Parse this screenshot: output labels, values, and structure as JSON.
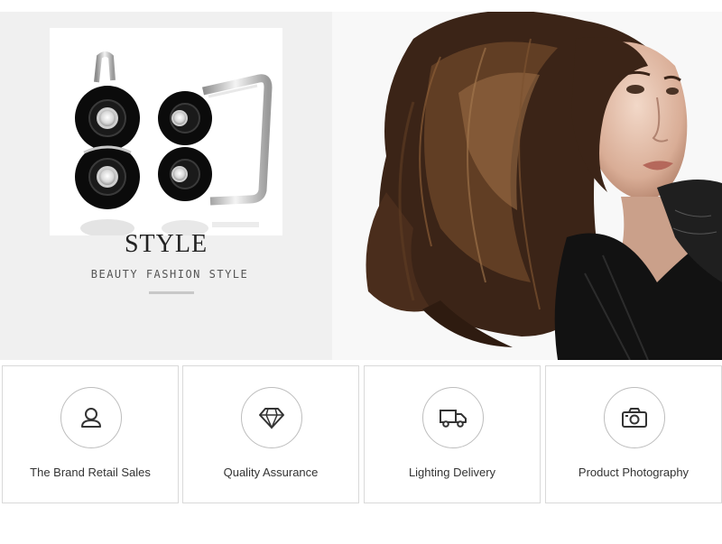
{
  "banner": {
    "title": "STYLE",
    "subtitle": "BEAUTY FASHION STYLE"
  },
  "features": [
    {
      "label": "The Brand Retail Sales",
      "icon": "user-icon"
    },
    {
      "label": "Quality Assurance",
      "icon": "diamond-icon"
    },
    {
      "label": "Lighting Delivery",
      "icon": "truck-icon"
    },
    {
      "label": "Product Photography",
      "icon": "camera-icon"
    }
  ],
  "colors": {
    "panel_background": "#f0f0f0",
    "text": "#333333",
    "border": "#d9d9d9"
  }
}
